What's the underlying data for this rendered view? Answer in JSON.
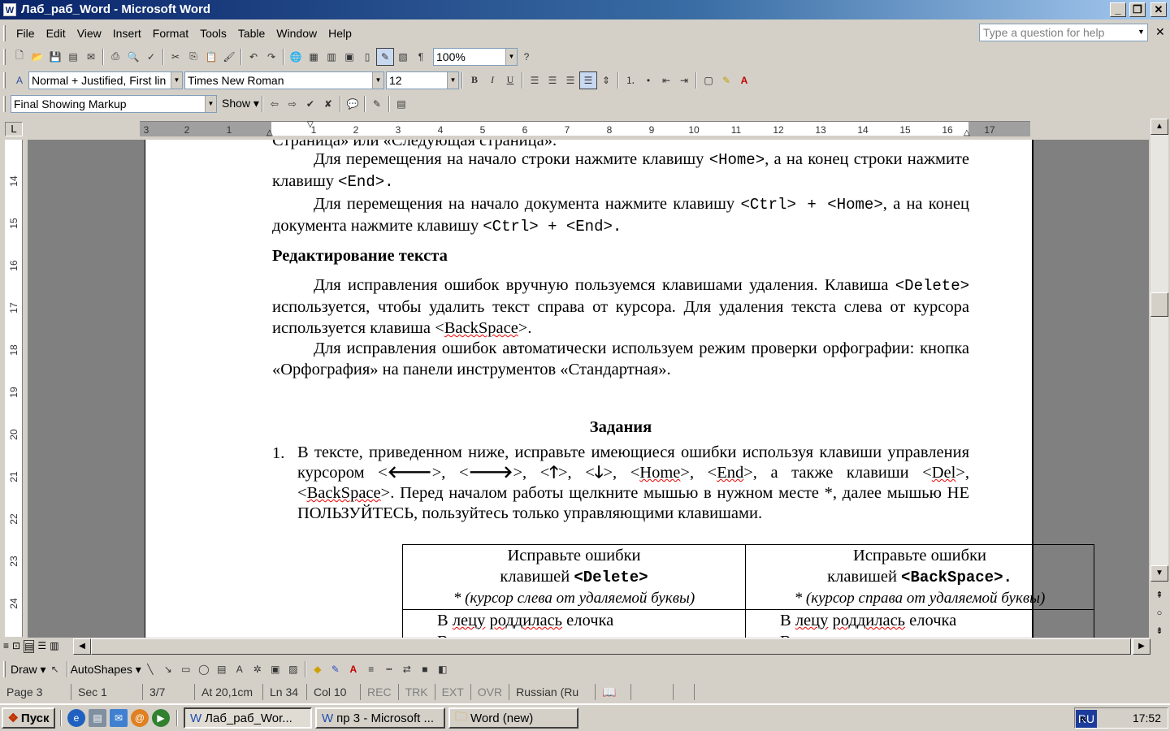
{
  "window": {
    "title": "Лаб_раб_Word - Microsoft Word"
  },
  "menu": {
    "items": [
      "File",
      "Edit",
      "View",
      "Insert",
      "Format",
      "Tools",
      "Table",
      "Window",
      "Help"
    ],
    "help_placeholder": "Type a question for help"
  },
  "standard_toolbar": {
    "zoom": "100%"
  },
  "formatting_toolbar": {
    "style": "Normal + Justified, First lin",
    "font": "Times New Roman",
    "size": "12",
    "bold": "B",
    "italic": "I",
    "underline": "U"
  },
  "reviewing_toolbar": {
    "display": "Final Showing Markup",
    "show": "Show"
  },
  "ruler": {
    "corner": "L",
    "h_ticks": [
      "3",
      "2",
      "1",
      "1",
      "2",
      "3",
      "4",
      "5",
      "6",
      "7",
      "8",
      "9",
      "10",
      "11",
      "12",
      "13",
      "14",
      "15",
      "16",
      "17"
    ],
    "v_ticks": [
      "14",
      "15",
      "16",
      "17",
      "18",
      "19",
      "20",
      "21",
      "22",
      "23",
      "24"
    ]
  },
  "document": {
    "cut_line": "Страница» или «Следующая страница».",
    "p1a": "Для перемещения на начало строки нажмите клавишу ",
    "p1_home": "<Home>",
    "p1b": ", а на конец строки нажмите клавишу ",
    "p1_end": "<End>.",
    "p2a": "Для перемещения на начало документа нажмите клавишу ",
    "p2_ctrlhome": "<Ctrl> + <Home>",
    "p2b": ", а на конец документа нажмите клавишу ",
    "p2_ctrlend": "<Ctrl> + <End>.",
    "heading": "Редактирование текста",
    "p3a": "Для исправления ошибок вручную пользуемся клавишами удаления. Клавиша ",
    "p3_del": "<Delete>",
    "p3b": " используется, чтобы удалить текст справа от курсора. Для удаления текста слева от курсора используется клавиша <",
    "p3_bs": "BackSpace",
    "p3c": ">.",
    "p4": "Для исправления ошибок автоматически используем режим проверки орфографии: кнопка «Орфография» на панели инструментов «Стандартная».",
    "tasks_heading": "Задания",
    "task_num": "1.",
    "task_a": "В тексте, приведенном ниже, исправьте имеющиеся ошибки используя клавиши управления курсором <",
    "arrow_left": "🡐",
    "arrow_right": "🡒",
    "arrow_up": "🡑",
    "arrow_down": "🡓",
    "task_home": "Home",
    "task_end": "End",
    "task_del": "Del",
    "task_bs": "BackSpace",
    "task_b": "Перед началом работы щелкните мышью в нужном месте *, далее мышью НЕ ПОЛЬЗУЙТЕСЬ,  пользуйтесь только управляющими клавишами.",
    "table": {
      "col1_line1": "Исправьте ошибки",
      "col1_line2a": "клавишей ",
      "col1_key": "<Delete>",
      "col1_note": "* (курсор слева от удаляемой буквы)",
      "col2_line1": "Исправьте ошибки",
      "col2_line2a": "клавишей ",
      "col2_key": "<BackSpace>.",
      "col2_note": "* (курсор справа от удаляемой буквы)",
      "row1_left_a": "В ",
      "row1_left_b": "лецу",
      "row1_left_c": " ",
      "row1_left_d": "роддилась",
      "row1_left_e": " елочка",
      "row1_right_a": "В ",
      "row1_right_b": "лецу",
      "row1_right_c": " ",
      "row1_right_d": "роддилась",
      "row1_right_e": " елочка",
      "row2_left": "В лецу она росла",
      "row2_right": "В лецу она росла"
    }
  },
  "drawing_toolbar": {
    "draw": "Draw",
    "autoshapes": "AutoShapes"
  },
  "status_bar": {
    "page": "Page 3",
    "sec": "Sec 1",
    "pos": "3/7",
    "at": "At 20,1cm",
    "ln": "Ln 34",
    "col": "Col 10",
    "rec": "REC",
    "trk": "TRK",
    "ext": "EXT",
    "ovr": "OVR",
    "lang": "Russian (Ru"
  },
  "taskbar": {
    "start": "Пуск",
    "tasks": [
      "Лаб_раб_Wor...",
      "пр 3 - Microsoft ...",
      "Word (new)"
    ],
    "lang": "RU",
    "time": "17:52"
  }
}
